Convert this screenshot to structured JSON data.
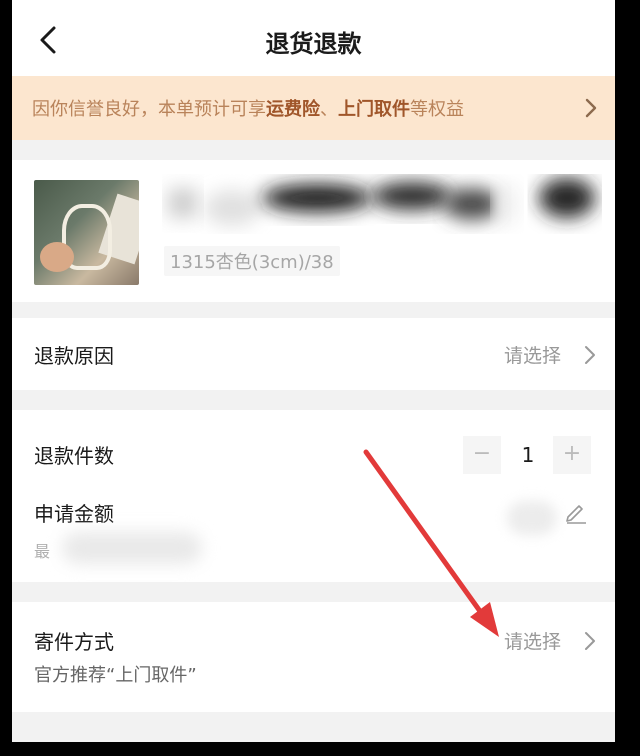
{
  "header": {
    "title": "退货退款",
    "back_icon": "chevron-left-icon"
  },
  "notice": {
    "prefix": "因你信誉良好，本单预计可享",
    "highlight_1": "运费险",
    "separator": "、",
    "highlight_2": "上门取件",
    "suffix": "等权益",
    "chevron_icon": "chevron-right-icon",
    "text_color": "#b9835a",
    "highlight_color": "#a0562a",
    "bg_color": "#fce6cf"
  },
  "product": {
    "spec": "1315杏色(3cm)/38"
  },
  "refund_reason": {
    "label": "退款原因",
    "placeholder": "请选择"
  },
  "refund_qty": {
    "label": "退款件数",
    "minus": "−",
    "value": "1",
    "plus": "+"
  },
  "amount": {
    "label": "申请金额",
    "max_prefix": "最",
    "edit_icon": "pencil-icon"
  },
  "shipping": {
    "label": "寄件方式",
    "placeholder": "请选择",
    "sub": "官方推荐“上门取件”"
  },
  "annotation": {
    "arrow_color": "#e23a3a"
  }
}
